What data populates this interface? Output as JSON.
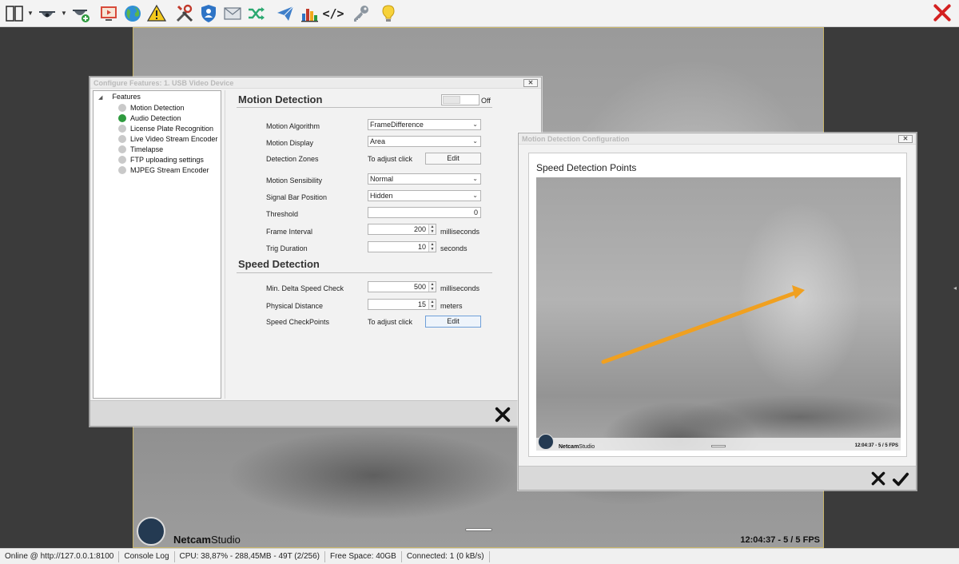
{
  "toolbar": {
    "buttons": [
      {
        "name": "layout-icon"
      },
      {
        "name": "camera-dome-icon"
      },
      {
        "name": "add-camera-icon"
      },
      {
        "name": "playback-icon"
      },
      {
        "name": "globe-icon"
      },
      {
        "name": "warning-icon"
      },
      {
        "name": "tools-icon"
      },
      {
        "name": "user-shield-icon"
      },
      {
        "name": "mail-icon"
      },
      {
        "name": "shuffle-icon"
      },
      {
        "name": "send-icon"
      },
      {
        "name": "bar-chart-icon"
      },
      {
        "name": "code-icon"
      },
      {
        "name": "key-icon"
      },
      {
        "name": "lightbulb-icon"
      }
    ],
    "code_glyph": "</>",
    "close_color": "#d42020"
  },
  "camera": {
    "logo_bold": "Netcam",
    "logo_light": "Studio",
    "timestamp": "12:04:37 - 5 / 5 FPS"
  },
  "config_dialog": {
    "title": "Configure Features: 1. USB Video Device",
    "tree": {
      "root": "Features",
      "items": [
        {
          "label": "Motion Detection",
          "active": false
        },
        {
          "label": "Audio Detection",
          "active": true
        },
        {
          "label": "License Plate Recognition",
          "active": false
        },
        {
          "label": "Live Video Stream Encoder",
          "active": false
        },
        {
          "label": "Timelapse",
          "active": false
        },
        {
          "label": "FTP uploading settings",
          "active": false
        },
        {
          "label": "MJPEG Stream Encoder",
          "active": false
        }
      ]
    },
    "motion": {
      "title": "Motion Detection",
      "toggle_label": "Off",
      "algorithm_label": "Motion Algorithm",
      "algorithm_value": "FrameDifference",
      "display_label": "Motion Display",
      "display_value": "Area",
      "zones_label": "Detection Zones",
      "zones_hint": "To adjust click",
      "zones_button": "Edit",
      "sensibility_label": "Motion Sensibility",
      "sensibility_value": "Normal",
      "signal_label": "Signal Bar Position",
      "signal_value": "Hidden",
      "threshold_label": "Threshold",
      "threshold_value": "0",
      "interval_label": "Frame Interval",
      "interval_value": "200",
      "interval_unit": "milliseconds",
      "trig_label": "Trig Duration",
      "trig_value": "10",
      "trig_unit": "seconds"
    },
    "speed": {
      "title": "Speed Detection",
      "delta_label": "Min. Delta Speed Check",
      "delta_value": "500",
      "delta_unit": "milliseconds",
      "distance_label": "Physical Distance",
      "distance_value": "15",
      "distance_unit": "meters",
      "checkpoints_label": "Speed CheckPoints",
      "checkpoints_hint": "To adjust click",
      "checkpoints_button": "Edit"
    }
  },
  "motion_config_dialog": {
    "title": "Motion Detection Configuration",
    "subtitle": "Speed Detection Points",
    "preview_logo_bold": "Netcam",
    "preview_logo_light": "Studio",
    "preview_time": "12:04:37 - 5 / 5 FPS",
    "arrow_color": "#f0a020"
  },
  "statusbar": {
    "online": "Online @ http://127.0.0.1:8100",
    "console": "Console Log",
    "cpu": "CPU: 38,87% - 288,45MB - 49T (2/256)",
    "space": "Free Space: 40GB",
    "connected": "Connected: 1 (0 kB/s)"
  }
}
